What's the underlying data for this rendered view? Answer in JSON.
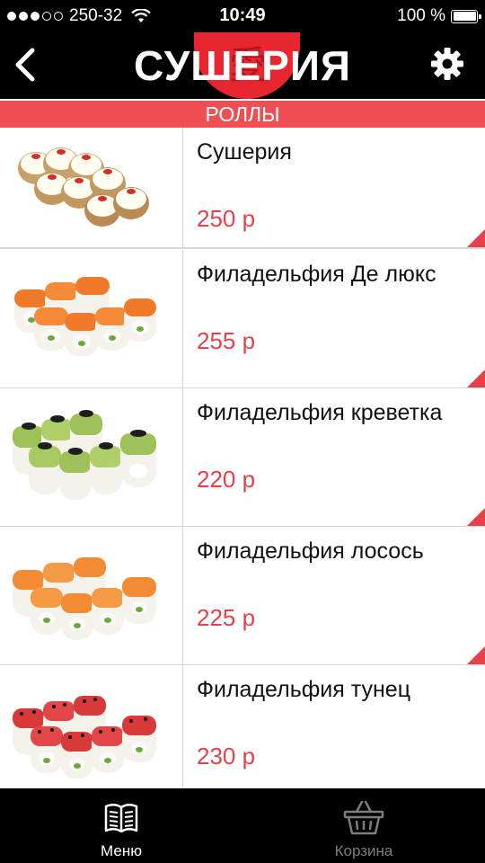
{
  "status_bar": {
    "carrier": "250-32",
    "time": "10:49",
    "battery": "100 %"
  },
  "header": {
    "logo": "СУШЕРИЯ",
    "back_icon": "chevron-left-icon",
    "settings_icon": "gear-icon"
  },
  "category": {
    "title": "РОЛЛЫ"
  },
  "items": [
    {
      "name": "Сушерия",
      "price": "250 р"
    },
    {
      "name": "Филадельфия Де люкс",
      "price": "255 р"
    },
    {
      "name": "Филадельфия креветка",
      "price": "220 р"
    },
    {
      "name": "Филадельфия лосось",
      "price": "225 р"
    },
    {
      "name": "Филадельфия тунец",
      "price": "230 р"
    }
  ],
  "tabs": {
    "menu_label": "Меню",
    "cart_label": "Корзина"
  },
  "colors": {
    "accent": "#ef4e52",
    "price": "#e8404a",
    "header_bg": "#000000"
  }
}
